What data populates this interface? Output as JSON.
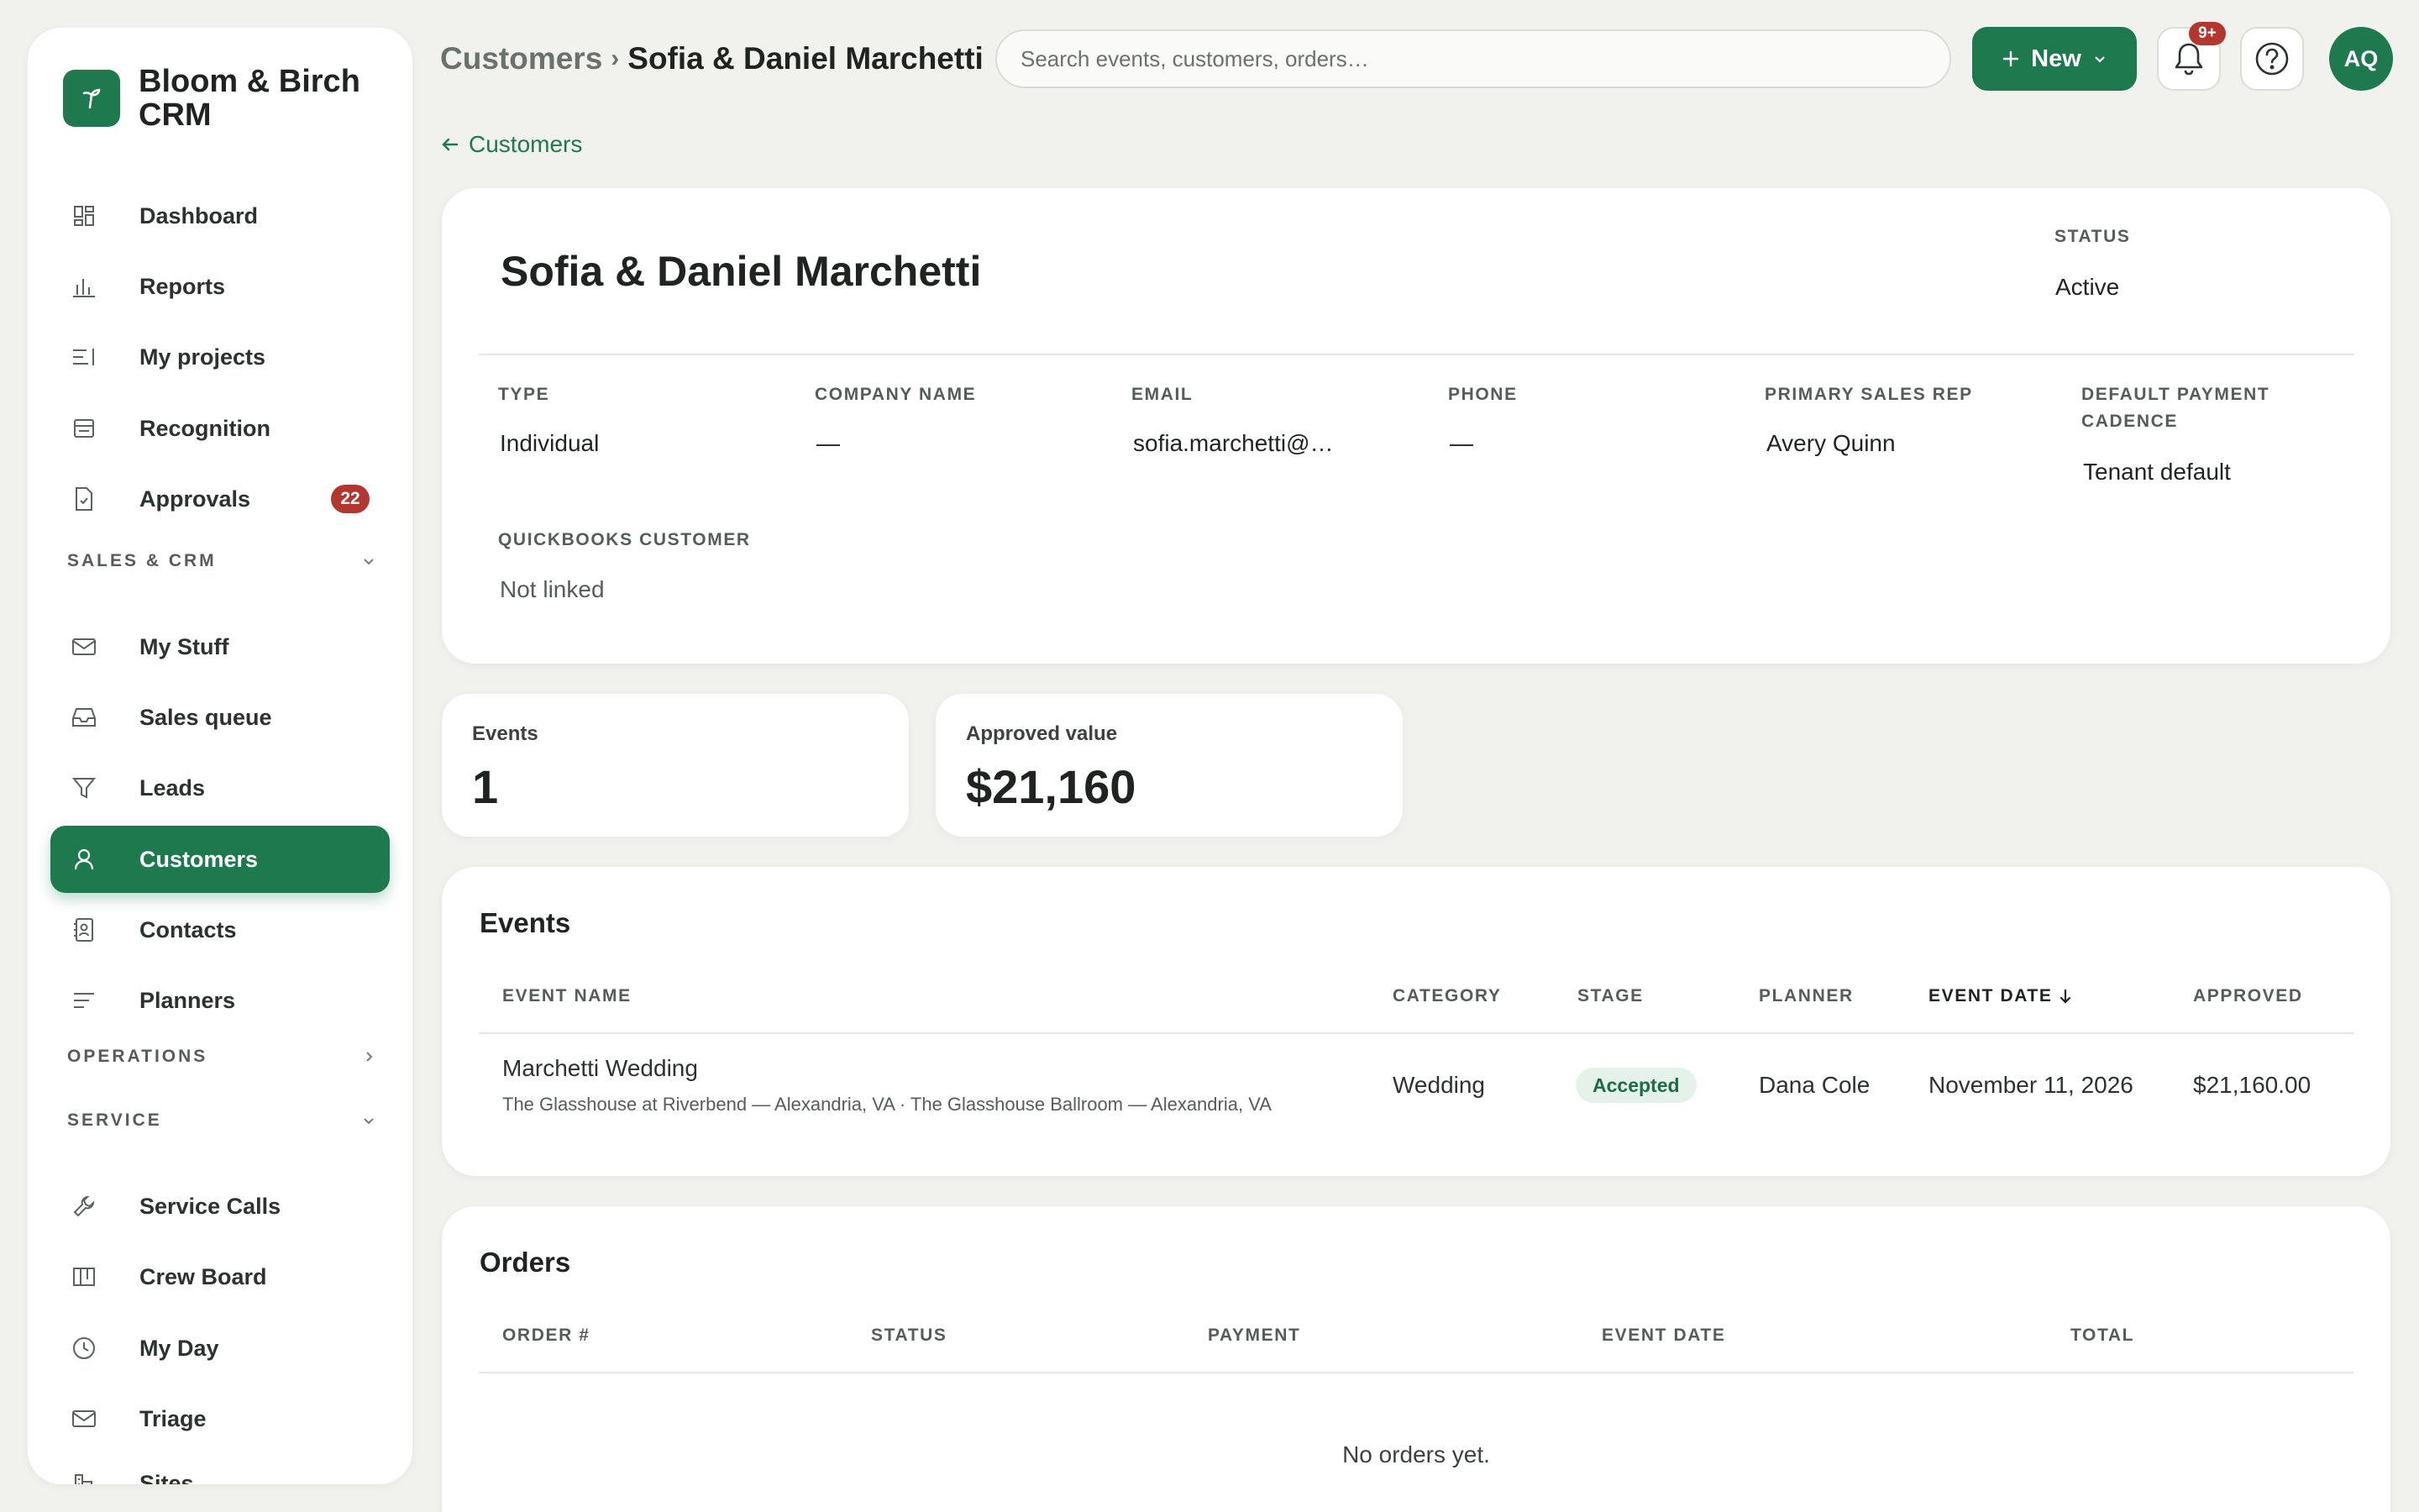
{
  "app": {
    "name": "Bloom & Birch CRM"
  },
  "sidebar": {
    "items": [
      {
        "label": "Dashboard",
        "icon": "dashboard-icon"
      },
      {
        "label": "Reports",
        "icon": "bar-chart-icon"
      },
      {
        "label": "My projects",
        "icon": "projects-icon"
      },
      {
        "label": "Recognition",
        "icon": "recognition-icon"
      },
      {
        "label": "Approvals",
        "icon": "document-check-icon",
        "badge": "22"
      }
    ],
    "sections": {
      "sales": {
        "label": "SALES & CRM",
        "items": [
          {
            "label": "My Stuff",
            "icon": "mail-icon"
          },
          {
            "label": "Sales queue",
            "icon": "inbox-icon"
          },
          {
            "label": "Leads",
            "icon": "funnel-icon"
          },
          {
            "label": "Customers",
            "icon": "user-icon",
            "active": true
          },
          {
            "label": "Contacts",
            "icon": "address-book-icon"
          },
          {
            "label": "Planners",
            "icon": "list-icon"
          }
        ]
      },
      "operations": {
        "label": "OPERATIONS"
      },
      "service": {
        "label": "SERVICE",
        "items": [
          {
            "label": "Service Calls",
            "icon": "wrench-icon"
          },
          {
            "label": "Crew Board",
            "icon": "board-icon"
          },
          {
            "label": "My Day",
            "icon": "clock-icon"
          },
          {
            "label": "Triage",
            "icon": "mail-icon"
          },
          {
            "label": "Sites",
            "icon": "building-icon"
          }
        ]
      }
    }
  },
  "header": {
    "breadcrumb": {
      "parent": "Customers",
      "separator": "›",
      "current": "Sofia & Daniel Marchetti"
    },
    "search_placeholder": "Search events, customers, orders…",
    "new_label": "New",
    "notif_badge": "9+",
    "avatar_initials": "AQ"
  },
  "back_link": "Customers",
  "customer": {
    "name": "Sofia & Daniel Marchetti",
    "status_label": "STATUS",
    "status": "Active",
    "fields": {
      "type": {
        "label": "TYPE",
        "value": "Individual"
      },
      "company": {
        "label": "COMPANY NAME",
        "value": "—"
      },
      "email": {
        "label": "EMAIL",
        "value": "sofia.marchetti@…"
      },
      "phone": {
        "label": "PHONE",
        "value": "—"
      },
      "sales_rep": {
        "label": "PRIMARY SALES REP",
        "value": "Avery Quinn"
      },
      "cadence": {
        "label_1": "DEFAULT PAYMENT",
        "label_2": "CADENCE",
        "value": "Tenant default"
      },
      "quickbooks": {
        "label": "QUICKBOOKS CUSTOMER",
        "value": "Not linked"
      }
    }
  },
  "stats": {
    "events": {
      "label": "Events",
      "value": "1"
    },
    "approved": {
      "label": "Approved value",
      "value": "$21,160"
    }
  },
  "events": {
    "title": "Events",
    "columns": [
      "EVENT NAME",
      "CATEGORY",
      "STAGE",
      "PLANNER",
      "EVENT DATE",
      "APPROVED"
    ],
    "rows": [
      {
        "name": "Marchetti Wedding",
        "venue": "The Glasshouse at Riverbend — Alexandria, VA · The Glasshouse Ballroom — Alexandria, VA",
        "category": "Wedding",
        "stage": "Accepted",
        "planner": "Dana Cole",
        "date": "November 11, 2026",
        "approved": "$21,160.00"
      }
    ]
  },
  "orders": {
    "title": "Orders",
    "columns": [
      "ORDER #",
      "STATUS",
      "PAYMENT",
      "EVENT DATE",
      "TOTAL"
    ],
    "empty": "No orders yet."
  },
  "colors": {
    "accent": "#1e7a4e",
    "badge": "#b3362f",
    "background": "#f1f1ee"
  }
}
